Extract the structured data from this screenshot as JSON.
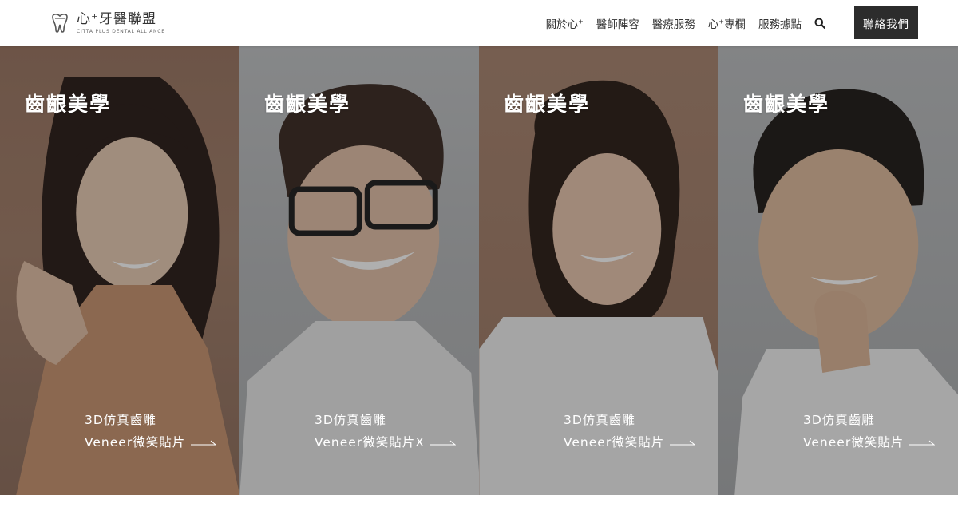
{
  "brand": {
    "title": "心⁺牙醫聯盟",
    "subtitle": "CITTA PLUS DENTAL ALLIANCE",
    "logo_icon": "tooth-sparkle-icon"
  },
  "nav": {
    "items": [
      {
        "label": "關於心",
        "sup": "+"
      },
      {
        "label": "醫師陣容",
        "sup": ""
      },
      {
        "label": "醫療服務",
        "sup": ""
      },
      {
        "label": "心",
        "sup": "+",
        "suffix": "專欄"
      },
      {
        "label": "服務據點",
        "sup": ""
      }
    ],
    "search_icon": "search-icon",
    "contact_label": "聯絡我們"
  },
  "panels": [
    {
      "title": "齒齦美學",
      "line1": "3D仿真齒雕",
      "line2": "Veneer微笑貼片",
      "bg": "#9a7561"
    },
    {
      "title": "齒齦美學",
      "line1": "3D仿真齒雕",
      "line2": "Veneer微笑貼片X",
      "bg": "#b7b9bb"
    },
    {
      "title": "齒齦美學",
      "line1": "3D仿真齒雕",
      "line2": "Veneer微笑貼片",
      "bg": "#a57f68"
    },
    {
      "title": "齒齦美學",
      "line1": "3D仿真齒雕",
      "line2": "Veneer微笑貼片",
      "bg": "#b4b6b8"
    }
  ],
  "colors": {
    "header_bg": "#ffffff",
    "contact_bg": "#2c2c2c",
    "overlay": "rgba(20,20,20,0.34)"
  }
}
